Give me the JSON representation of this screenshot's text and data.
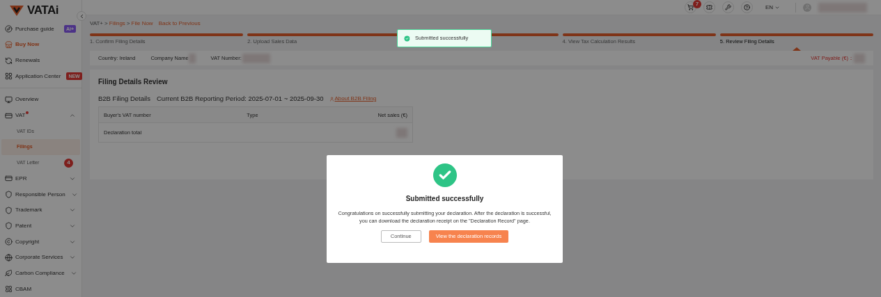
{
  "brand": {
    "name": "VATAi"
  },
  "sidebar": {
    "items": [
      {
        "kind": "item",
        "label": "Purchase guide",
        "badge": "Ai+",
        "selected": false
      },
      {
        "kind": "item",
        "label": "Buy Now",
        "highlight": true,
        "selected": false
      },
      {
        "kind": "item",
        "label": "Renewals",
        "selected": false
      },
      {
        "kind": "item",
        "label": "Application Center",
        "badge": "NEW",
        "selected": false
      },
      {
        "kind": "divider"
      },
      {
        "kind": "item",
        "label": "Overview",
        "selected": false
      },
      {
        "kind": "group",
        "label": "VAT",
        "dot": true,
        "expanded": true,
        "children": [
          {
            "label": "VAT IDs",
            "selected": false
          },
          {
            "label": "Filings",
            "selected": true
          },
          {
            "label": "VAT Letter",
            "count": "4",
            "selected": false
          }
        ]
      },
      {
        "kind": "group",
        "label": "EPR",
        "expanded": false
      },
      {
        "kind": "group",
        "label": "Responsible Person",
        "expanded": false
      },
      {
        "kind": "group",
        "label": "Trademark",
        "expanded": false
      },
      {
        "kind": "group",
        "label": "Patent",
        "expanded": false
      },
      {
        "kind": "group",
        "label": "Copyright",
        "expanded": false
      },
      {
        "kind": "group",
        "label": "Corporate Services",
        "expanded": false
      },
      {
        "kind": "group",
        "label": "Carbon Compliance",
        "expanded": false
      },
      {
        "kind": "item",
        "label": "CBAM",
        "selected": false
      }
    ]
  },
  "topbar": {
    "cart_count": "7",
    "language": "EN"
  },
  "breadcrumb": {
    "items": [
      "VAT+",
      "Filings",
      "File Now"
    ],
    "separator": ">",
    "back": "Back to Previous"
  },
  "steps": [
    {
      "label": "1. Confirm Filing Details",
      "selected": false
    },
    {
      "label": "2. Upload Sales Data",
      "selected": false
    },
    {
      "selected": false
    },
    {
      "label": "4. View Tax Calculation Results",
      "selected": false
    },
    {
      "label": "5. Review Filing Details",
      "selected": true
    }
  ],
  "info": {
    "country": "Country: Ireland",
    "company": "Company Name",
    "vat_number": "VAT Number:",
    "vat_payable": "VAT Payable (€)："
  },
  "review": {
    "title": "Filing Details Review",
    "section": "B2B Filing Details",
    "period": "Current B2B Reporting Period: 2025-07-01 ~ 2025-09-30",
    "link": "About B2B Filing",
    "table": {
      "columns": [
        "Buyer's VAT number",
        "Type",
        "Net sales (€)"
      ],
      "rows": [
        [
          "Declaration total",
          "",
          ""
        ]
      ]
    }
  },
  "toast": {
    "text": "Submitted successfully"
  },
  "dialog": {
    "title": "Submitted successfully",
    "message": "Congratulations on successfully submitting your declaration. After the declaration is successful, you can download the declaration receipt on the \"Declaration Record\" page.",
    "buttons": [
      {
        "label": "Continue",
        "kind": "secondary"
      },
      {
        "label": "View the declaration records",
        "kind": "primary"
      }
    ]
  }
}
